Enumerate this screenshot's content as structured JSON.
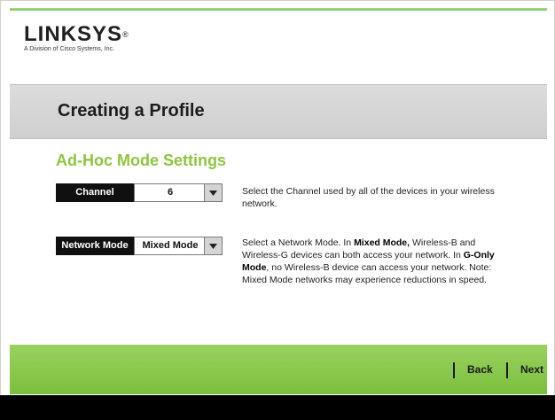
{
  "brand": {
    "name": "LINKSYS",
    "registered": "®",
    "tagline": "A Division of Cisco Systems, Inc."
  },
  "page": {
    "title": "Creating a Profile",
    "section_title": "Ad-Hoc Mode Settings"
  },
  "channel": {
    "label": "Channel",
    "value": "6",
    "description": "Select the Channel used by all of the devices in your wireless network."
  },
  "network_mode": {
    "label": "Network Mode",
    "value": "Mixed Mode",
    "desc_1": "Select a Network Mode. In ",
    "desc_bold_1": "Mixed Mode,",
    "desc_2": " Wireless-B and Wireless-G devices can both access your network. In ",
    "desc_bold_2": "G-Only Mode",
    "desc_3": ", no Wireless-B device can access your network. Note: Mixed Mode networks may experience reductions in speed."
  },
  "nav": {
    "back_label": "Back",
    "next_label": "Next"
  },
  "colors": {
    "accent_green": "#8cc63f",
    "footer_green": "#7bbf3d",
    "band_gray": "#d6d6d6"
  }
}
